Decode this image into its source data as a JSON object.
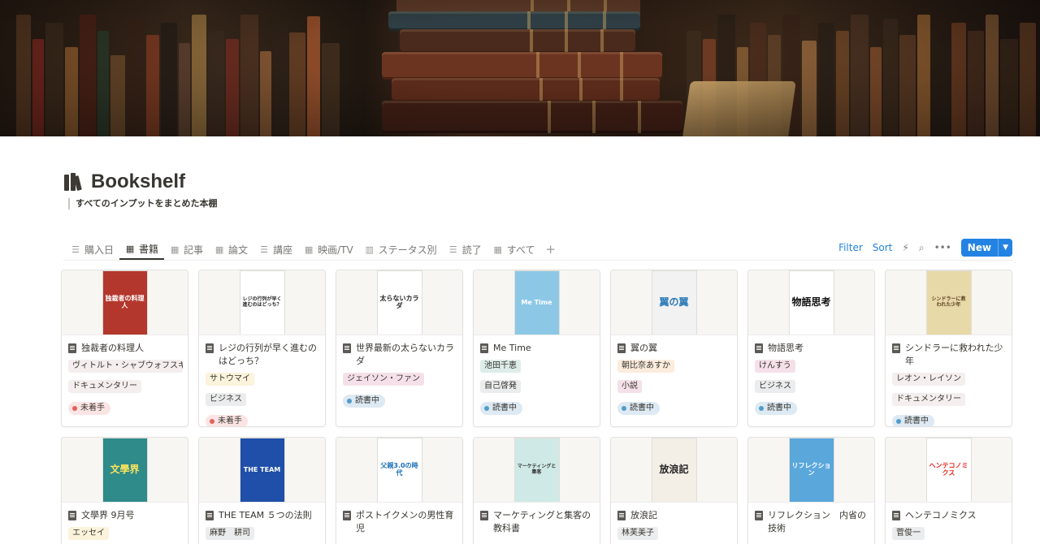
{
  "page": {
    "title": "Bookshelf",
    "subtitle": "すべてのインプットをまとめた本棚"
  },
  "tabs": [
    {
      "label": "購入日",
      "icon": "list-icon",
      "glyph": "☰"
    },
    {
      "label": "書籍",
      "icon": "gallery-icon",
      "glyph": "▦"
    },
    {
      "label": "記事",
      "icon": "gallery-icon",
      "glyph": "▦"
    },
    {
      "label": "論文",
      "icon": "gallery-icon",
      "glyph": "▦"
    },
    {
      "label": "講座",
      "icon": "list-icon",
      "glyph": "☰"
    },
    {
      "label": "映画/TV",
      "icon": "gallery-icon",
      "glyph": "▦"
    },
    {
      "label": "ステータス別",
      "icon": "board-icon",
      "glyph": "▥"
    },
    {
      "label": "読了",
      "icon": "list-icon",
      "glyph": "☰"
    },
    {
      "label": "すべて",
      "icon": "gallery-icon",
      "glyph": "▦"
    }
  ],
  "active_tab": "書籍",
  "toolbar": {
    "filter": "Filter",
    "sort": "Sort",
    "new": "New"
  },
  "colors": {
    "accent": "#2383e2",
    "tag_author_pink": "#f5e0e9",
    "tag_author_orange": "#fbecdd",
    "tag_author_yellow": "#fbf3db",
    "tag_author_green": "#ddedea",
    "tag_author_brown": "#f4eeee",
    "tag_gray": "#ebeced",
    "status_red": "#fbe4e4",
    "status_blue": "#dde9f3"
  },
  "cards": [
    {
      "title": "独裁者の料理人",
      "author": "ヴィトルト・シャブウォフスキ",
      "author_color": "#f4eeee",
      "genre": "ドキュメンタリー",
      "genre_color": "#f4eeee",
      "status": "未着手",
      "status_bg": "#fbe4e4",
      "status_dot": "#e16259",
      "cover_bg": "#b3372c",
      "cover_fg": "#ffffff",
      "cover_text": "独裁者の料理人"
    },
    {
      "title": "レジの行列が早く進むのはどっち？",
      "author": "サトウマイ",
      "author_color": "#fbf3db",
      "genre": "ビジネス",
      "genre_color": "#ebeced",
      "status": "未着手",
      "status_bg": "#fbe4e4",
      "status_dot": "#e16259",
      "cover_bg": "#ffffff",
      "cover_fg": "#222222",
      "cover_text": "レジの行列が早く進むのはどっち？"
    },
    {
      "title": "世界最新の太らないカラダ",
      "author": "ジェイソン・ファン",
      "author_color": "#f5e0e9",
      "genre": "",
      "genre_color": "",
      "status": "読書中",
      "status_bg": "#dde9f3",
      "status_dot": "#529cca",
      "cover_bg": "#ffffff",
      "cover_fg": "#222222",
      "cover_text": "太らないカラダ"
    },
    {
      "title": "Me Time",
      "author": "池田千恵",
      "author_color": "#ddedea",
      "genre": "自己啓発",
      "genre_color": "#ebeced",
      "status": "読書中",
      "status_bg": "#dde9f3",
      "status_dot": "#529cca",
      "cover_bg": "#8cc8e6",
      "cover_fg": "#ffffff",
      "cover_text": "Me Time"
    },
    {
      "title": "翼の翼",
      "author": "朝比奈あすか",
      "author_color": "#fbecdd",
      "genre": "小説",
      "genre_color": "#f5e0e9",
      "status": "読書中",
      "status_bg": "#dde9f3",
      "status_dot": "#529cca",
      "cover_bg": "#f2f2f2",
      "cover_fg": "#2a7ab8",
      "cover_text": "翼の翼"
    },
    {
      "title": "物語思考",
      "author": "けんすう",
      "author_color": "#f5e0e9",
      "genre": "ビジネス",
      "genre_color": "#ebeced",
      "status": "読書中",
      "status_bg": "#dde9f3",
      "status_dot": "#529cca",
      "cover_bg": "#ffffff",
      "cover_fg": "#111111",
      "cover_text": "物語思考"
    },
    {
      "title": "シンドラーに救われた少年",
      "author": "レオン・レイソン",
      "author_color": "#f4eeee",
      "genre": "ドキュメンタリー",
      "genre_color": "#f4eeee",
      "status": "読書中",
      "status_bg": "#dde9f3",
      "status_dot": "#529cca",
      "cover_bg": "#e8d9a8",
      "cover_fg": "#5a4020",
      "cover_text": "シンドラーに救われた少年"
    },
    {
      "title": "文學界 9月号",
      "author": "エッセイ",
      "author_color": "#fbf3db",
      "genre": "",
      "genre_color": "",
      "status": "",
      "status_bg": "",
      "status_dot": "",
      "cover_bg": "#2f8a8a",
      "cover_fg": "#ffe55c",
      "cover_text": "文學界"
    },
    {
      "title": "THE TEAM ５つの法則",
      "author": "麻野　耕司",
      "author_color": "#ebeced",
      "genre": "",
      "genre_color": "",
      "status": "",
      "status_bg": "",
      "status_dot": "",
      "cover_bg": "#1f4fa8",
      "cover_fg": "#ffffff",
      "cover_text": "THE TEAM"
    },
    {
      "title": "ポストイクメンの男性育児",
      "author": "",
      "author_color": "",
      "genre": "",
      "genre_color": "",
      "status": "",
      "status_bg": "",
      "status_dot": "",
      "cover_bg": "#ffffff",
      "cover_fg": "#1a6fb8",
      "cover_text": "父親3.0の時代"
    },
    {
      "title": "マーケティングと集客の教科書",
      "author": "",
      "author_color": "",
      "genre": "",
      "genre_color": "",
      "status": "",
      "status_bg": "",
      "status_dot": "",
      "cover_bg": "#cfeae6",
      "cover_fg": "#333333",
      "cover_text": "マーケティングと集客"
    },
    {
      "title": "放浪記",
      "author": "林芙美子",
      "author_color": "#ebeced",
      "genre": "",
      "genre_color": "",
      "status": "",
      "status_bg": "",
      "status_dot": "",
      "cover_bg": "#f4efe6",
      "cover_fg": "#222222",
      "cover_text": "放浪記"
    },
    {
      "title": "リフレクション　内省の技術",
      "author": "",
      "author_color": "",
      "genre": "",
      "genre_color": "",
      "status": "",
      "status_bg": "",
      "status_dot": "",
      "cover_bg": "#5aa7dc",
      "cover_fg": "#ffffff",
      "cover_text": "リフレクション"
    },
    {
      "title": "ヘンテコノミクス",
      "author": "菅俊一",
      "author_color": "#ebeced",
      "genre": "",
      "genre_color": "",
      "status": "",
      "status_bg": "",
      "status_dot": "",
      "cover_bg": "#ffffff",
      "cover_fg": "#e0261c",
      "cover_text": "ヘンテコノミクス"
    }
  ]
}
